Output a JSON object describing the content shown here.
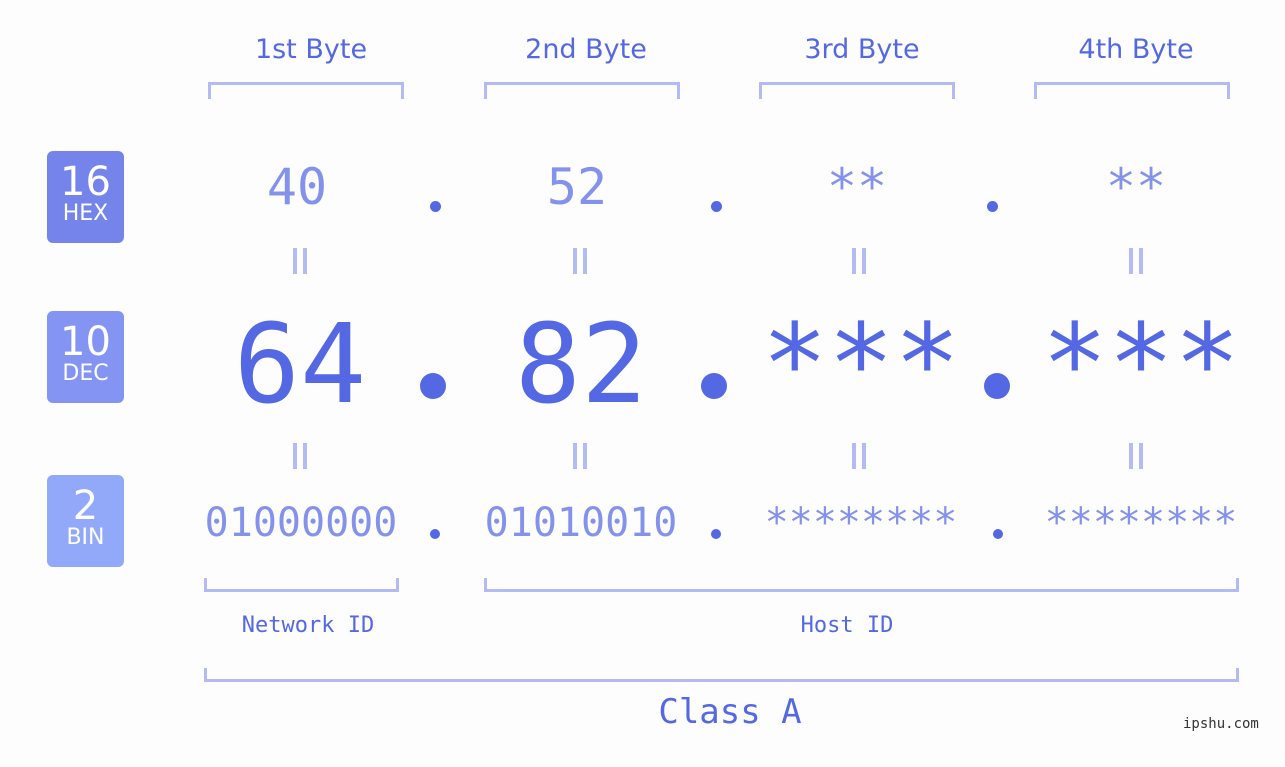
{
  "bytes": {
    "headers": [
      "1st Byte",
      "2nd Byte",
      "3rd Byte",
      "4th Byte"
    ],
    "hex": [
      "40",
      "52",
      "**",
      "**"
    ],
    "dec": [
      "64",
      "82",
      "***",
      "***"
    ],
    "bin": [
      "01000000",
      "01010010",
      "********",
      "********"
    ]
  },
  "badges": {
    "hex": {
      "num": "16",
      "label": "HEX",
      "color": "#7584ea"
    },
    "dec": {
      "num": "10",
      "label": "DEC",
      "color": "#8494f2"
    },
    "bin": {
      "num": "2",
      "label": "BIN",
      "color": "#92a8f8"
    }
  },
  "ids": {
    "network": "Network ID",
    "host": "Host ID"
  },
  "class_label": "Class A",
  "watermark": "ipshu.com",
  "colors": {
    "accent": "#5468e3",
    "light": "#8492ec",
    "bracket": "#b3baf4"
  }
}
